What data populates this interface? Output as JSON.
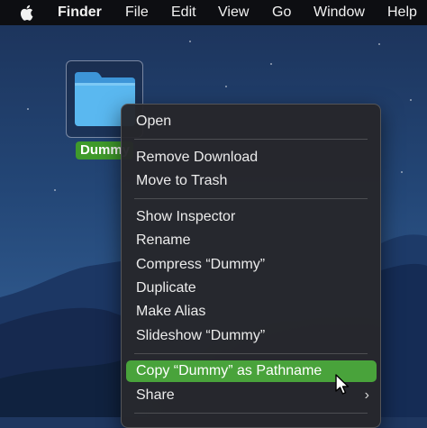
{
  "menubar": {
    "apple_icon": "apple-logo",
    "items": [
      "Finder",
      "File",
      "Edit",
      "View",
      "Go",
      "Window",
      "Help"
    ]
  },
  "desktop": {
    "folder": {
      "icon": "folder-icon",
      "label": "Dummy"
    }
  },
  "context_menu": {
    "items": [
      {
        "label": "Open"
      },
      {
        "label": "Remove Download"
      },
      {
        "label": "Move to Trash"
      },
      {
        "label": "Show Inspector"
      },
      {
        "label": "Rename"
      },
      {
        "label": "Compress “Dummy”"
      },
      {
        "label": "Duplicate"
      },
      {
        "label": "Make Alias"
      },
      {
        "label": "Slideshow “Dummy”"
      },
      {
        "label": "Copy “Dummy” as Pathname",
        "highlighted": true
      },
      {
        "label": "Share",
        "submenu_icon": "chevron-right-icon"
      }
    ]
  },
  "colors": {
    "menubar_bg": "#0d0e12",
    "menu_bg": "#26272b",
    "highlight": "#49a33b",
    "folder_label_bg": "#3f9a2b",
    "folder_blue": "#5ab8f0"
  }
}
